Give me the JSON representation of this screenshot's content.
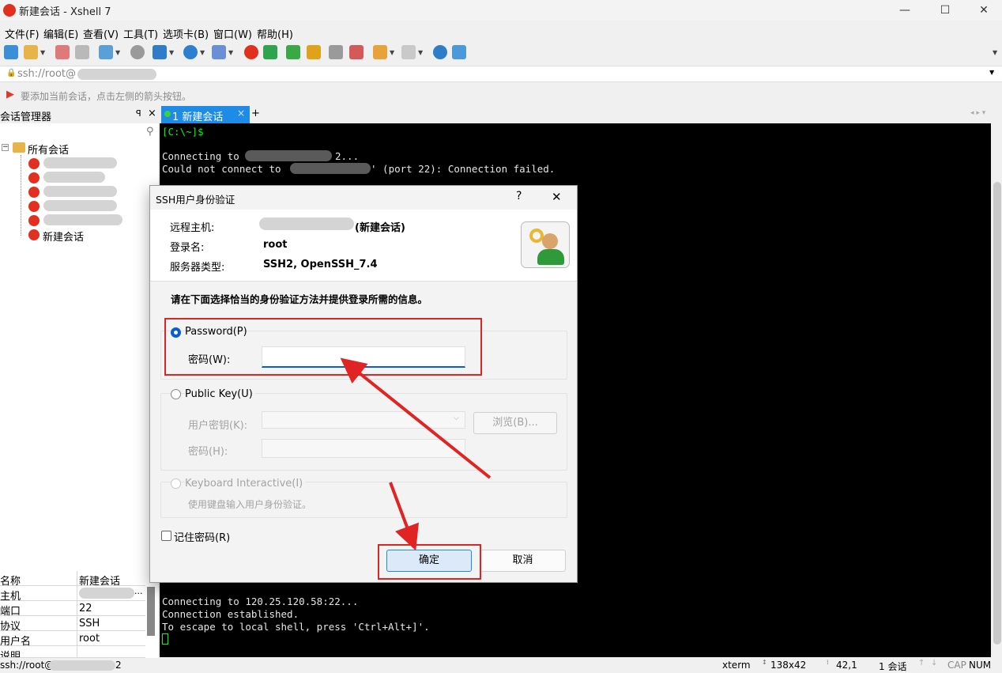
{
  "window": {
    "title": "新建会话 - Xshell 7",
    "minimize": "—",
    "maximize": "☐",
    "close": "✕"
  },
  "menu": [
    "文件(F)",
    "编辑(E)",
    "查看(V)",
    "工具(T)",
    "选项卡(B)",
    "窗口(W)",
    "帮助(H)"
  ],
  "address_bar": {
    "value": "ssh://root@"
  },
  "hint_bar": {
    "text": "要添加当前会话，点击左侧的箭头按钮。"
  },
  "session_manager": {
    "title": "会话管理器",
    "pin": "ꟼ",
    "close": "×",
    "root": "所有会话",
    "new_session": "新建会话"
  },
  "tab": {
    "label": "1 新建会话",
    "close": "×",
    "add": "+"
  },
  "terminal": {
    "prompt": "[C:\\~]$",
    "line1_a": "Connecting to",
    "line1_b": "2...",
    "line2_a": "Could not connect to",
    "line2_b": "' (port 22): Connection failed.",
    "line3": "Connecting to 120.25.120.58:22...",
    "line4": "Connection established.",
    "line5": "To escape to local shell, press 'Ctrl+Alt+]'."
  },
  "properties": [
    {
      "key": "名称",
      "value": "新建会话"
    },
    {
      "key": "主机",
      "value": "..."
    },
    {
      "key": "端口",
      "value": "22"
    },
    {
      "key": "协议",
      "value": "SSH"
    },
    {
      "key": "用户名",
      "value": "root"
    },
    {
      "key": "说明",
      "value": ""
    }
  ],
  "status": {
    "left_a": "ssh://root@",
    "left_b": "2",
    "term": "xterm",
    "size": "138x42",
    "pos": "42,1",
    "sessions": "1 会话",
    "caps": "CAP",
    "num": "NUM"
  },
  "dialog": {
    "title": "SSH用户身份验证",
    "help": "?",
    "close": "✕",
    "remote_host_label": "远程主机:",
    "remote_host_suffix": "(新建会话)",
    "login_label": "登录名:",
    "login_value": "root",
    "server_type_label": "服务器类型:",
    "server_type_value": "SSH2, OpenSSH_7.4",
    "instruction": "请在下面选择恰当的身份验证方法并提供登录所需的信息。",
    "password_method": "Password(P)",
    "password_label": "密码(W):",
    "password_value": "",
    "pubkey_method": "Public Key(U)",
    "user_key_label": "用户密钥(K):",
    "browse": "浏览(B)...",
    "passphrase_label": "密码(H):",
    "keyboard_method": "Keyboard Interactive(I)",
    "keyboard_desc": "使用键盘输入用户身份验证。",
    "remember": "记住密码(R)",
    "ok": "确定",
    "cancel": "取消"
  },
  "colors": {
    "accent": "#1e8ce6",
    "annotation": "#e02424",
    "terminal_bg": "#000000",
    "prompt": "#00ff00"
  }
}
